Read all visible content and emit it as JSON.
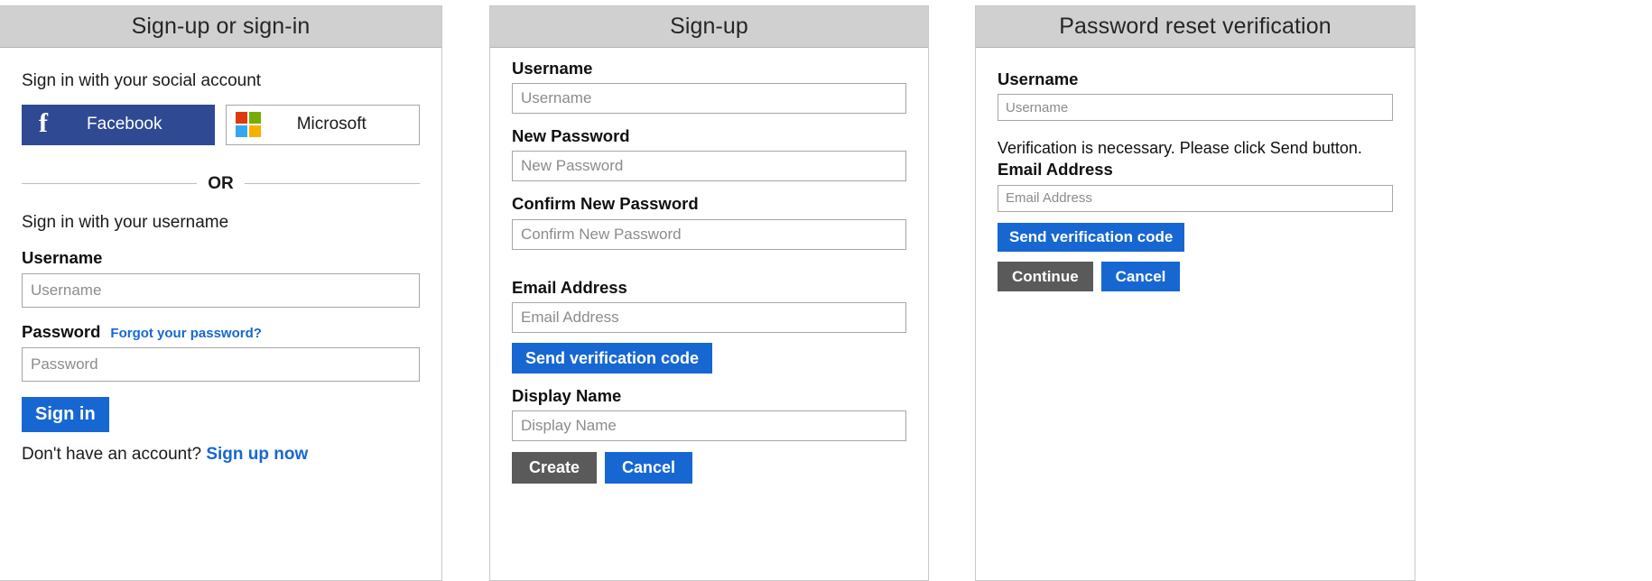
{
  "panels": [
    {
      "title": "Sign-up or sign-in",
      "social_lead": "Sign in with your social account",
      "facebook": {
        "label": "Facebook",
        "glyph": "f",
        "color": "#2f4a93"
      },
      "microsoft": {
        "label": "Microsoft",
        "tile_colors": [
          "#df3a0e",
          "#77ad00",
          "#34a7ef",
          "#f6b000"
        ]
      },
      "or_text": "OR",
      "username_lead": "Sign in with your username",
      "username_label": "Username",
      "username_placeholder": "Username",
      "username_value": "",
      "password_label": "Password",
      "forgot_link": "Forgot your password?",
      "password_placeholder": "Password",
      "password_value": "",
      "signin_button": "Sign in",
      "no_account_text": "Don't have an account?",
      "signup_link": "Sign up now"
    },
    {
      "title": "Sign-up",
      "username_label": "Username",
      "username_placeholder": "Username",
      "username_value": "",
      "new_password_label": "New Password",
      "new_password_placeholder": "New Password",
      "new_password_value": "",
      "confirm_password_label": "Confirm New Password",
      "confirm_password_placeholder": "Confirm New Password",
      "confirm_password_value": "",
      "email_label": "Email Address",
      "email_placeholder": "Email Address",
      "email_value": "",
      "send_code_button": "Send verification code",
      "display_name_label": "Display Name",
      "display_name_placeholder": "Display Name",
      "display_name_value": "",
      "create_button": "Create",
      "cancel_button": "Cancel"
    },
    {
      "title": "Password reset verification",
      "username_label": "Username",
      "username_placeholder": "Username",
      "username_value": "",
      "verification_note": "Verification is necessary. Please click Send button.",
      "email_label": "Email Address",
      "email_placeholder": "Email Address",
      "email_value": "",
      "send_code_button": "Send verification code",
      "continue_button": "Continue",
      "cancel_button": "Cancel"
    }
  ],
  "colors": {
    "accent_blue": "#1767d2",
    "grey_button": "#5a5a5a",
    "header_grey": "#d0d0d0",
    "facebook_blue": "#2f4a93",
    "border_grey": "#a6a6a6"
  }
}
